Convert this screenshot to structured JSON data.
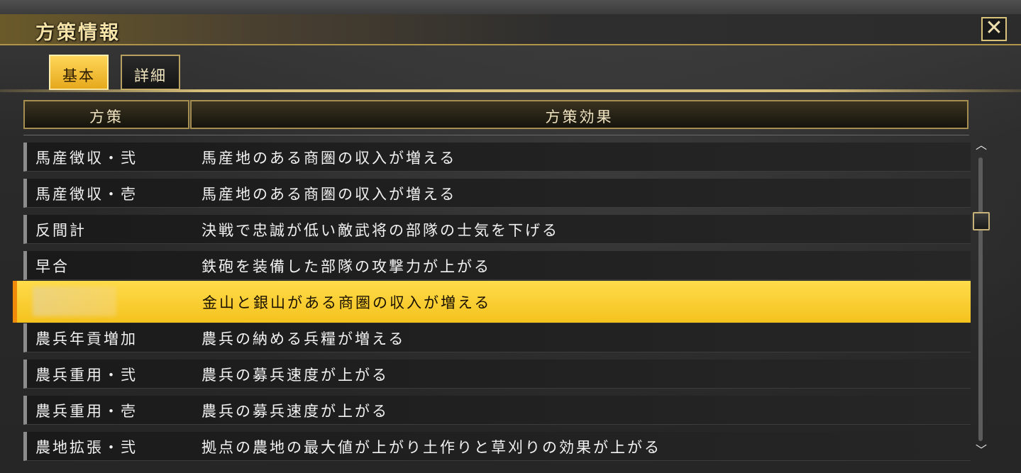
{
  "window": {
    "title": "方策情報",
    "close_glyph": "✕"
  },
  "tabs": [
    {
      "label": "基本",
      "active": true
    },
    {
      "label": "詳細",
      "active": false
    }
  ],
  "table": {
    "headers": {
      "name": "方策",
      "effect": "方策効果"
    },
    "rows": [
      {
        "name": "馬産徴収・弐",
        "effect": "馬産地のある商圏の収入が増える"
      },
      {
        "name": "馬産徴収・壱",
        "effect": "馬産地のある商圏の収入が増える"
      },
      {
        "name": "反間計",
        "effect": "決戦で忠誠が低い敵武将の部隊の士気を下げる"
      },
      {
        "name": "早合",
        "effect": "鉄砲を装備した部隊の攻撃力が上がる"
      },
      {
        "name": "",
        "effect": "金山と銀山がある商圏の収入が増える",
        "selected": true
      },
      {
        "name": "農兵年貢増加",
        "effect": "農兵の納める兵糧が増える"
      },
      {
        "name": "農兵重用・弐",
        "effect": "農兵の募兵速度が上がる"
      },
      {
        "name": "農兵重用・壱",
        "effect": "農兵の募兵速度が上がる"
      },
      {
        "name": "農地拡張・弐",
        "effect": "拠点の農地の最大値が上がり土作りと草刈りの効果が上がる"
      }
    ]
  },
  "scrollbar": {
    "up_glyph": "︿",
    "down_glyph": "﹀",
    "position": 0.2
  },
  "colors": {
    "accent_gold": "#f4c21e",
    "selected_edge": "#f08a0a",
    "frame_gold": "#b0944a"
  }
}
